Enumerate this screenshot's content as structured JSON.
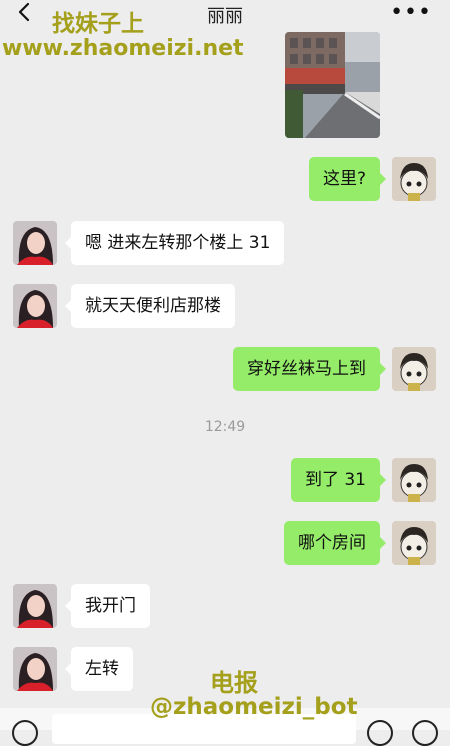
{
  "header": {
    "title": "丽丽",
    "more_icon": "more-icon"
  },
  "watermark": {
    "top_line1": "找妹子上",
    "top_line2": "www.zhaomeizi.net",
    "bottom_line1": "电报",
    "bottom_line2": "@zhaomeizi_bot"
  },
  "messages": [
    {
      "side": "out",
      "type": "image"
    },
    {
      "side": "out",
      "text": "这里?"
    },
    {
      "side": "in",
      "text": "嗯 进来左转那个楼上 31"
    },
    {
      "side": "in",
      "text": "就天天便利店那楼"
    },
    {
      "side": "out",
      "text": "穿好丝袜马上到"
    },
    {
      "side": "out",
      "text": "到了 31"
    },
    {
      "side": "out",
      "text": "哪个房间"
    },
    {
      "side": "in",
      "text": "我开门"
    },
    {
      "side": "in",
      "text": "左转"
    }
  ],
  "timestamp": "12:49",
  "colors": {
    "background": "#ededed",
    "outgoing_bubble": "#95ec69",
    "incoming_bubble": "#ffffff"
  }
}
